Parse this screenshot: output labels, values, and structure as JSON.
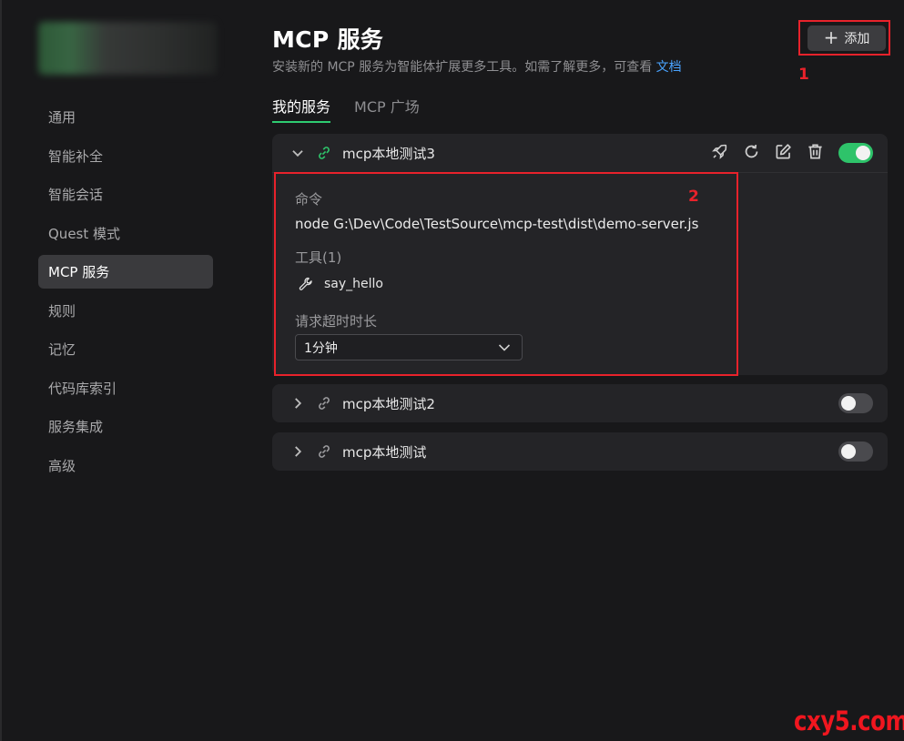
{
  "sidebar": {
    "items": [
      {
        "label": "通用",
        "active": false
      },
      {
        "label": "智能补全",
        "active": false
      },
      {
        "label": "智能会话",
        "active": false
      },
      {
        "label": "Quest 模式",
        "active": false
      },
      {
        "label": "MCP 服务",
        "active": true
      },
      {
        "label": "规则",
        "active": false
      },
      {
        "label": "记忆",
        "active": false
      },
      {
        "label": "代码库索引",
        "active": false
      },
      {
        "label": "服务集成",
        "active": false
      },
      {
        "label": "高级",
        "active": false
      }
    ]
  },
  "header": {
    "title": "MCP 服务",
    "subtitle": "安装新的 MCP 服务为智能体扩展更多工具。如需了解更多，可查看 ",
    "doc_link": "文档",
    "add_label": "添加"
  },
  "tabs": [
    {
      "label": "我的服务",
      "active": true
    },
    {
      "label": "MCP 广场",
      "active": false
    }
  ],
  "servers": [
    {
      "name": "mcp本地测试3",
      "enabled": true,
      "expanded": true,
      "command_label": "命令",
      "command": "node G:\\Dev\\Code\\TestSource\\mcp-test\\dist\\demo-server.js",
      "tools_label": "工具(1)",
      "tools": [
        "say_hello"
      ],
      "timeout_label": "请求超时时长",
      "timeout_value": "1分钟"
    },
    {
      "name": "mcp本地测试2",
      "enabled": false,
      "expanded": false
    },
    {
      "name": "mcp本地测试",
      "enabled": false,
      "expanded": false
    }
  ],
  "annotations": {
    "box1": "1",
    "box2": "2"
  },
  "watermark": "cxy5.com",
  "colors": {
    "accent": "#2ec36a",
    "link": "#4aa3ff",
    "annotation": "#e8222b"
  }
}
